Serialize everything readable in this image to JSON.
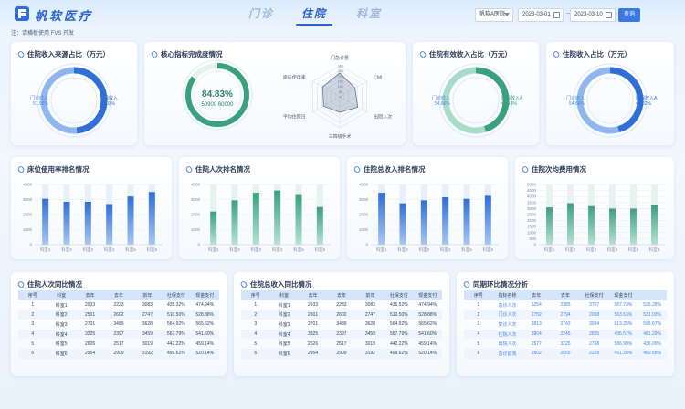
{
  "header": {
    "brand": "帆软医疗",
    "tabs": [
      {
        "label": "门诊",
        "active": false
      },
      {
        "label": "住院",
        "active": true
      },
      {
        "label": "科室",
        "active": false
      }
    ],
    "hospital_select": "帆软A医院",
    "date_start": "2023-03-01",
    "date_end": "2023-03-10",
    "query_button": "查询",
    "note": "注：请横板使用 FVS 开发"
  },
  "colors": {
    "primary": "#2f6fd6",
    "teal": "#3aa17e",
    "accent": "#4a86e0"
  },
  "donut_source": {
    "title": "住院收入来源占比（万元）",
    "chart_data": {
      "type": "pie",
      "slices": [
        {
          "name": "医保收入",
          "value": 49.03,
          "label": "49.03%"
        },
        {
          "name": "门诊收入",
          "value": 51.96,
          "label": "51.96%"
        }
      ]
    }
  },
  "kpi": {
    "title": "核心指标完成度情况",
    "percent": "84.83%",
    "ratio": "50900 60000",
    "chart_data": {
      "type": "radar",
      "axes": [
        "门急诊量",
        "CMI",
        "出院人次",
        "三四级手术",
        "平均住院日",
        "病床使用率"
      ],
      "ticks": [
        "0",
        "50",
        "100",
        "150",
        "200",
        "250",
        "300"
      ],
      "max": 300,
      "values": [
        230,
        170,
        200,
        150,
        180,
        190
      ]
    }
  },
  "donut_effective": {
    "title": "住院有效收入占比（万元）",
    "chart_data": {
      "type": "pie",
      "slices": [
        {
          "name": "医保收入A",
          "value": 45.14,
          "label": "45.14%"
        },
        {
          "name": "门诊收入",
          "value": 54.86,
          "label": "54.86%"
        }
      ]
    }
  },
  "donut_income": {
    "title": "住院收入占比（万元）",
    "chart_data": {
      "type": "pie",
      "slices": [
        {
          "name": "医保收入A",
          "value": 45.82,
          "label": "45.82%"
        },
        {
          "name": "门诊收入",
          "value": 54.86,
          "label": "54.86%"
        }
      ]
    }
  },
  "bar_bed": {
    "title": "床位使用率排名情况",
    "chart_data": {
      "type": "bar",
      "categories": [
        "科室1",
        "科室2",
        "科室3",
        "科室4",
        "科室5",
        "科室6"
      ],
      "values": [
        3050,
        2850,
        2850,
        2700,
        3200,
        3500
      ],
      "ylim": [
        0,
        4000
      ],
      "yticks": [
        "0",
        "1000",
        "2000",
        "3000",
        "4000"
      ]
    }
  },
  "bar_people": {
    "title": "住院人次排名情况",
    "chart_data": {
      "type": "bar",
      "categories": [
        "科室1",
        "科室2",
        "科室3",
        "科室4",
        "科室5",
        "科室6"
      ],
      "values": [
        2200,
        2950,
        3450,
        3600,
        3300,
        2500
      ],
      "ylim": [
        0,
        4000
      ],
      "yticks": [
        "0",
        "1000",
        "2000",
        "3000",
        "4000"
      ]
    }
  },
  "bar_income": {
    "title": "住院总收入排名情况",
    "chart_data": {
      "type": "bar",
      "categories": [
        "科室1",
        "科室2",
        "科室3",
        "科室4",
        "科室5",
        "科室6"
      ],
      "values": [
        3450,
        2750,
        2950,
        3150,
        3050,
        3250
      ],
      "ylim": [
        0,
        4000
      ],
      "yticks": [
        "0",
        "1000",
        "2000",
        "3000",
        "4000"
      ]
    }
  },
  "bar_cost": {
    "title": "住院次均费用情况",
    "chart_data": {
      "type": "bar",
      "categories": [
        "科室1",
        "科室2",
        "科室3",
        "科室4",
        "科室5",
        "科室6"
      ],
      "values": [
        3100,
        3450,
        3200,
        3000,
        3000,
        3300
      ],
      "ylim": [
        0,
        5000
      ],
      "yticks": [
        "0",
        "500",
        "1000",
        "1500",
        "2000",
        "2500",
        "3000",
        "3500",
        "4000",
        "4500",
        "5000"
      ]
    }
  },
  "table_people": {
    "title": "住院人次同比情况",
    "headers": [
      "序号",
      "科室",
      "去年",
      "去年",
      "前年",
      "社保支付",
      "现金支付"
    ],
    "rows": [
      [
        "1",
        "科室1",
        "2933",
        "2233",
        "3083",
        "435.32%",
        "474.94%"
      ],
      [
        "2",
        "科室2",
        "2501",
        "2602",
        "2747",
        "510.50%",
        "528.88%"
      ],
      [
        "3",
        "科室3",
        "2701",
        "3489",
        "3628",
        "564.92%",
        "565.62%"
      ],
      [
        "4",
        "科室4",
        "3325",
        "2397",
        "3459",
        "567.79%",
        "541.60%"
      ],
      [
        "5",
        "科室5",
        "2626",
        "2517",
        "3019",
        "442.22%",
        "459.14%"
      ],
      [
        "6",
        "科室6",
        "2954",
        "2909",
        "3192",
        "499.62%",
        "520.14%"
      ]
    ]
  },
  "table_income": {
    "title": "住院总收入同比情况",
    "headers": [
      "序号",
      "科室",
      "去年",
      "去年",
      "前年",
      "社保支付",
      "现金支付"
    ],
    "rows": [
      [
        "1",
        "科室1",
        "2933",
        "2233",
        "3083",
        "435.52%",
        "474.94%"
      ],
      [
        "2",
        "科室2",
        "2501",
        "2602",
        "2747",
        "510.50%",
        "528.88%"
      ],
      [
        "3",
        "科室3",
        "2701",
        "3489",
        "3628",
        "564.92%",
        "565.62%"
      ],
      [
        "4",
        "科室4",
        "3325",
        "2397",
        "3459",
        "567.79%",
        "541.60%"
      ],
      [
        "5",
        "科室5",
        "2626",
        "2517",
        "3019",
        "442.22%",
        "459.14%"
      ],
      [
        "6",
        "科室6",
        "2954",
        "2909",
        "3192",
        "499.62%",
        "520.14%"
      ]
    ]
  },
  "table_ring": {
    "title": "同期环比情况分析",
    "headers": [
      "序号",
      "指标名称",
      "去年",
      "去年",
      "社保支付",
      "现金支付"
    ],
    "rows": [
      [
        "1",
        "急诊人次",
        "3254",
        "2385",
        "3707",
        "587.73%",
        "535.28%"
      ],
      [
        "2",
        "门诊人次",
        "2752",
        "2794",
        "2068",
        "563.63%",
        "531.03%"
      ],
      [
        "3",
        "复诊人次",
        "2813",
        "3743",
        "3984",
        "613.25%",
        "596.67%"
      ],
      [
        "4",
        "住院人次",
        "3804",
        "2245",
        "2835",
        "495.57%",
        "481.29%"
      ],
      [
        "5",
        "出院人次",
        "2577",
        "3225",
        "2768",
        "586.99%",
        "436.09%"
      ],
      [
        "6",
        "急诊留观",
        "2802",
        "2655",
        "2209",
        "451.28%",
        "480.68%"
      ]
    ]
  }
}
